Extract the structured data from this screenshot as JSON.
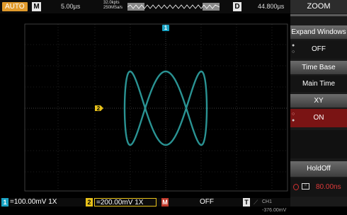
{
  "topbar": {
    "run_state": "AUTO",
    "mode_badge": "M",
    "timebase": "5.00µs",
    "mem_depth": "32.0kpts",
    "sample_rate": "250MSa/s",
    "delay_badge": "D",
    "delay_value": "44.800µs"
  },
  "menu": {
    "title": "ZOOM",
    "expand_windows": "Expand Windows",
    "expand_value": "OFF",
    "time_base": "Time Base",
    "main_time": "Main Time",
    "xy": "XY",
    "xy_value": "ON",
    "holdoff": "HoldOff",
    "holdoff_value": "80.00ns"
  },
  "markers": {
    "ch1": "1",
    "ch2": "2"
  },
  "bottom": {
    "ch1_num": "1",
    "ch1_value": "=100.00mV 1X",
    "ch2_num": "2",
    "ch2_value": "=200.00mV 1X",
    "math_badge": "M",
    "math_value": "OFF",
    "trigger_badge": "T",
    "trigger_value": "CH1 -376.00mV"
  },
  "colors": {
    "ch1": "#1aa3c4",
    "ch2": "#e8c21a",
    "math": "#c0392b",
    "trace": "#2fa3a3",
    "accent": "#e09a2c",
    "selected": "#7a1414"
  }
}
